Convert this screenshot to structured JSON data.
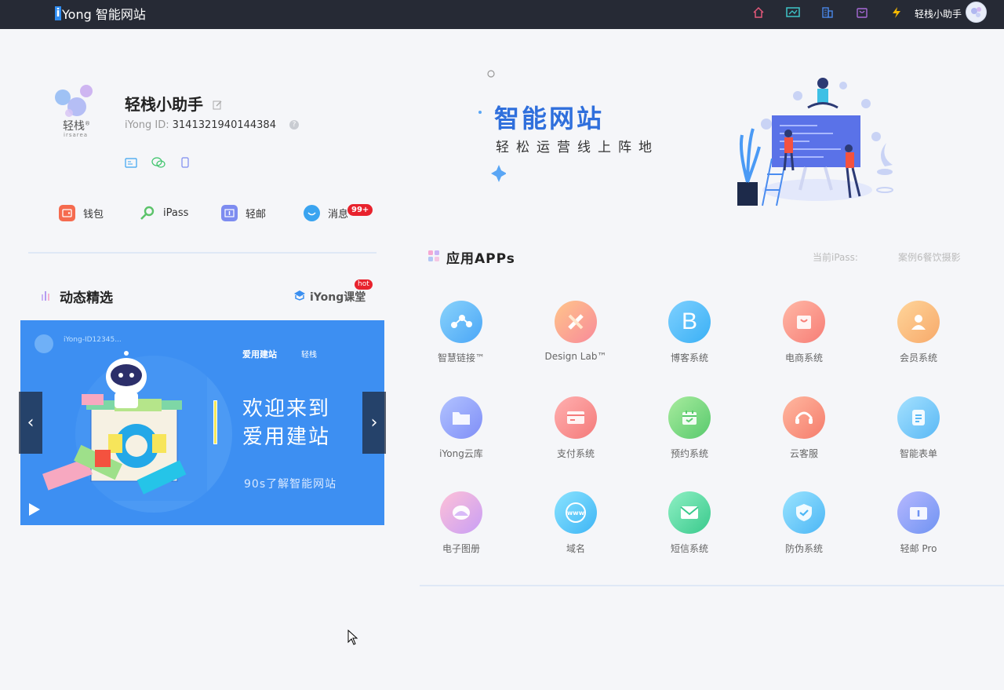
{
  "topbar": {
    "brand_i": "i",
    "brand_rest": "Yong 智能网站",
    "icons": [
      "home-icon",
      "chart-screen-icon",
      "building-icon",
      "shopping-bag-icon",
      "lightning-icon"
    ],
    "user_name": "轻栈小助手"
  },
  "profile": {
    "logo_text": "轻栈",
    "logo_reg": "®",
    "logo_sub": "irsarea",
    "name": "轻栈小助手",
    "id_label": "iYong ID:",
    "id_value": "3141321940144384",
    "help": "?"
  },
  "quick_links": [
    {
      "label": "钱包",
      "icon": "wallet-icon",
      "color": "#f56b4f"
    },
    {
      "label": "iPass",
      "icon": "key-icon",
      "color": "#5cc36a"
    },
    {
      "label": "轻邮",
      "icon": "mail-icon",
      "color": "#7d8cf0"
    },
    {
      "label": "消息",
      "icon": "message-icon",
      "color": "#3aa4f0"
    }
  ],
  "message_badge": "99+",
  "news": {
    "title": "动态精选",
    "course_link": "iYong课堂",
    "hot_badge": "hot"
  },
  "carousel": {
    "headline_1": "欢迎来到",
    "headline_2": "爱用建站",
    "subtitle": "90s了解智能网站",
    "brand_1": "爱用建站",
    "brand_2": "轻栈",
    "user_id": "iYong-ID12345...",
    "prev": "‹",
    "next": "›"
  },
  "banner": {
    "title": "智能网站",
    "subtitle": "轻松运营线上阵地"
  },
  "apps": {
    "title": "应用APPs",
    "ipass_label": "当前iPass:",
    "ipass_value": "案例6餐饮摄影",
    "items": [
      {
        "label": "智慧链接™",
        "icon": "link-nodes-icon",
        "c1": "#8ad3fb",
        "c2": "#4aa6f7"
      },
      {
        "label": "Design Lab™",
        "icon": "pencil-ruler-icon",
        "c1": "#ffc58a",
        "c2": "#f88a9a"
      },
      {
        "label": "博客系统",
        "icon": "blog-b-icon",
        "c1": "#7ed0ff",
        "c2": "#3ab0f5"
      },
      {
        "label": "电商系统",
        "icon": "shop-bag-icon",
        "c1": "#ffb8a6",
        "c2": "#f77d76"
      },
      {
        "label": "会员系统",
        "icon": "member-icon",
        "c1": "#ffd59a",
        "c2": "#f7a96a"
      },
      {
        "label": "iYong云库",
        "icon": "folder-icon",
        "c1": "#b2c3ff",
        "c2": "#7f8ef7"
      },
      {
        "label": "支付系统",
        "icon": "payment-card-icon",
        "c1": "#ffb0b0",
        "c2": "#f47a7a"
      },
      {
        "label": "预约系统",
        "icon": "calendar-icon",
        "c1": "#a8ec9e",
        "c2": "#58c96d"
      },
      {
        "label": "云客服",
        "icon": "headset-icon",
        "c1": "#ffb8a0",
        "c2": "#f57c6c"
      },
      {
        "label": "智能表单",
        "icon": "form-icon",
        "c1": "#a5e1ff",
        "c2": "#59b8f5"
      },
      {
        "label": "电子图册",
        "icon": "photo-album-icon",
        "c1": "#ffc1d7",
        "c2": "#c89ef5"
      },
      {
        "label": "域名",
        "icon": "www-globe-icon",
        "c1": "#8ae3ff",
        "c2": "#3eb5f5"
      },
      {
        "label": "短信系统",
        "icon": "sms-envelope-icon",
        "c1": "#8ff0c4",
        "c2": "#39c98c"
      },
      {
        "label": "防伪系统",
        "icon": "shield-check-icon",
        "c1": "#9be4ff",
        "c2": "#4bb6f5"
      },
      {
        "label": "轻邮 Pro",
        "icon": "mail-pro-icon",
        "c1": "#b7b8ff",
        "c2": "#6f93f2"
      }
    ]
  }
}
